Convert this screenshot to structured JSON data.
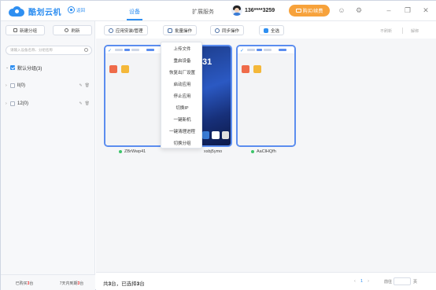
{
  "app": {
    "brand": "酷划云机",
    "home_label": "返回"
  },
  "nav": {
    "tabs": [
      {
        "label": "设备",
        "active": true
      },
      {
        "label": "扩展服务",
        "active": false
      }
    ]
  },
  "user": {
    "phone": "136****3259",
    "renew_label": "购买/续费"
  },
  "sidebar": {
    "new_group_label": "新建分组",
    "refresh_label": "刷新",
    "search_placeholder": "请输入设备名称、分组名称",
    "groups": [
      {
        "label": "默认分组(3)",
        "checked": true,
        "expanded": true
      },
      {
        "label": "ll(0)",
        "checked": false,
        "expanded": false
      },
      {
        "label": "12(0)",
        "checked": false,
        "expanded": false
      }
    ],
    "footer": {
      "bought_prefix": "已购买",
      "bought_count": "3",
      "bought_suffix": "台",
      "expiring_prefix": "7天内到期",
      "expiring_count": "3",
      "expiring_suffix": "台"
    }
  },
  "toolbar": {
    "app_install_label": "应用安装/管理",
    "batch_ops_label": "批量操作",
    "sync_ops_label": "同步操作",
    "select_all_label": "全选",
    "no_refresh_label": "不刷新",
    "unbind_label": "解绑"
  },
  "batch_menu": {
    "items": [
      "上传文件",
      "重启设备",
      "恢复出厂设置",
      "启动应用",
      "停止应用",
      "切换IP",
      "一键新机",
      "一键清理进程",
      "切换分组"
    ]
  },
  "devices": [
    {
      "name": "ZBrWwp41",
      "online": true
    },
    {
      "name": "xsbj5ymo",
      "online": true,
      "clock": "31"
    },
    {
      "name": "AaClHQfh",
      "online": true
    }
  ],
  "footer": {
    "total_prefix": "共",
    "total_count": "3",
    "total_mid": "台，已选择",
    "selected_count": "3",
    "selected_suffix": "台",
    "page_prev": "‹",
    "page_current": "1",
    "page_next": "›",
    "goto_prefix": "前往",
    "goto_suffix": "页"
  },
  "colors": {
    "accent": "#2f8ff1",
    "renew": "#f7a23b",
    "online": "#3cc46a",
    "highlight": "#e33333"
  }
}
